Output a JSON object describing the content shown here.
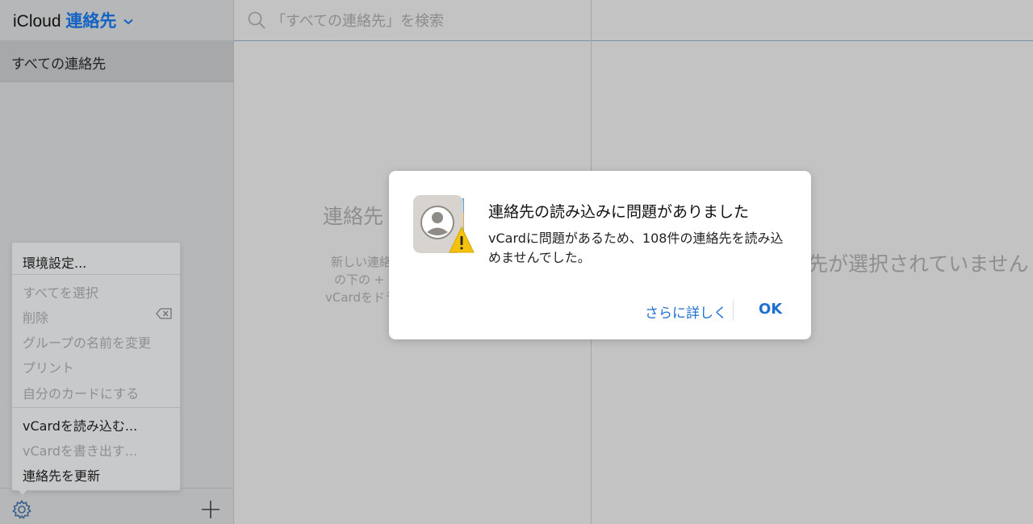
{
  "app": {
    "brand": "iCloud",
    "name": "連絡先"
  },
  "sidebar": {
    "groups": [
      {
        "label": "すべての連絡先"
      }
    ]
  },
  "search": {
    "placeholder": "「すべての連絡先」を検索"
  },
  "list_empty": {
    "title": "連絡先",
    "lines": [
      "新しい連絡先",
      "の下の + ボ",
      "vCardをドラッ"
    ]
  },
  "detail_empty": {
    "text": "先が選択されていません"
  },
  "context_menu": {
    "items": [
      {
        "label": "環境設定...",
        "enabled": true
      },
      {
        "label": "すべてを選択",
        "enabled": false
      },
      {
        "label": "削除",
        "enabled": false
      },
      {
        "label": "グループの名前を変更",
        "enabled": false
      },
      {
        "label": "プリント",
        "enabled": false
      },
      {
        "label": "自分のカードにする",
        "enabled": false
      },
      {
        "label": "vCardを読み込む...",
        "enabled": true
      },
      {
        "label": "vCardを書き出す...",
        "enabled": false
      },
      {
        "label": "連絡先を更新",
        "enabled": true
      }
    ]
  },
  "dialog": {
    "title": "連絡先の読み込みに問題がありました",
    "message": "vCardに問題があるため、108件の連絡先を読み込めませんでした。",
    "learn_more": "さらに詳しく",
    "ok": "OK"
  },
  "colors": {
    "accent": "#1263c4",
    "button_text": "#1f6fd0",
    "warning": "#f4c20d"
  },
  "icons": [
    "chevron-down-icon",
    "search-icon",
    "delete-key-icon",
    "gear-icon",
    "plus-icon",
    "contacts-app-icon",
    "warning-icon"
  ]
}
